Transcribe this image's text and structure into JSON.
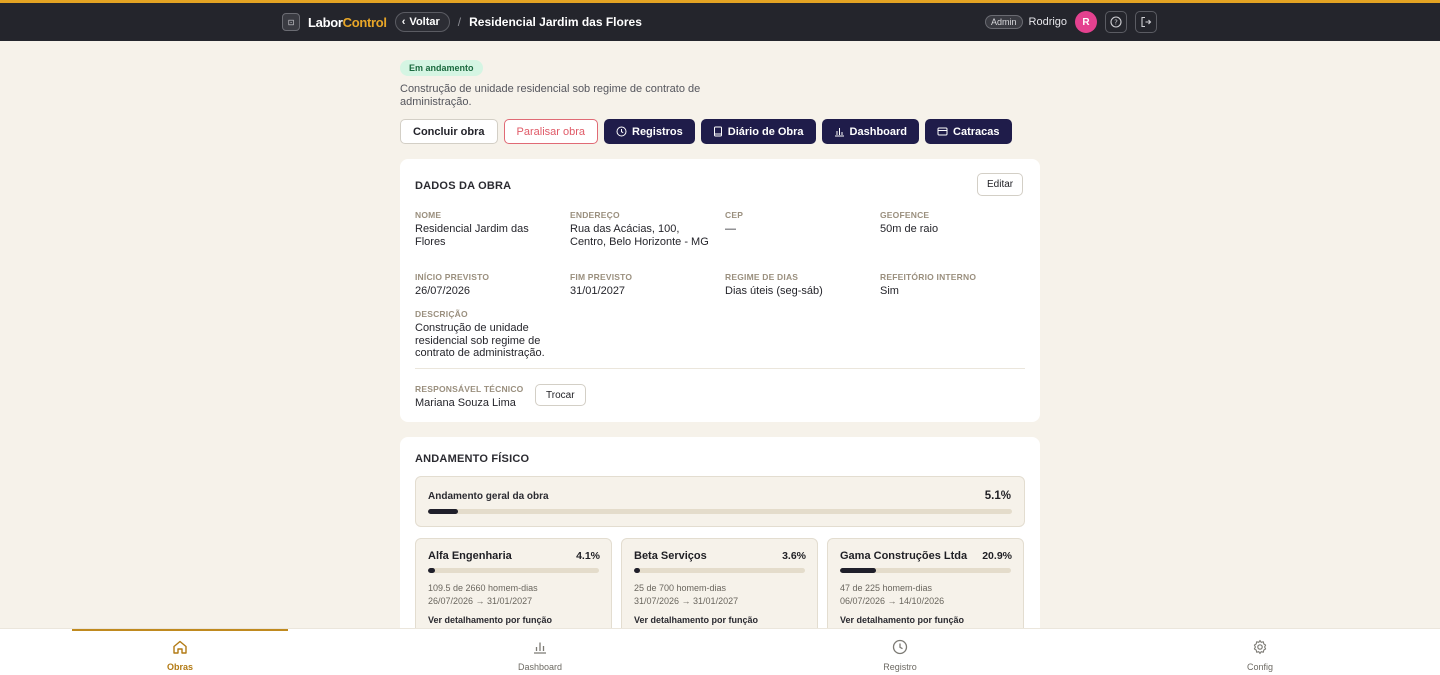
{
  "header": {
    "brand_part1": "Labor",
    "brand_part2": "Control",
    "back_label": "Voltar",
    "breadcrumb_sep": "/",
    "page_title": "Residencial Jardim das Flores",
    "role_badge": "Admin",
    "user_name": "Rodrigo",
    "avatar_initial": "R",
    "accent_color": "#e3a323"
  },
  "status": "Em andamento",
  "description": "Construção de unidade residencial sob regime de contrato de administração.",
  "actions": {
    "finish": "Concluir obra",
    "pause": "Paralisar obra",
    "records": "Registros",
    "diary": "Diário de Obra",
    "dashboard": "Dashboard",
    "turnstiles": "Catracas"
  },
  "details": {
    "title": "DADOS DA OBRA",
    "edit": "Editar",
    "fields": {
      "name": {
        "label": "NOME",
        "value": "Residencial Jardim das Flores"
      },
      "address": {
        "label": "ENDEREÇO",
        "value": "Rua das Acácias, 100, Centro, Belo Horizonte - MG"
      },
      "cep": {
        "label": "CEP",
        "value": "—"
      },
      "geofence": {
        "label": "GEOFENCE",
        "value": "50m de raio"
      },
      "start": {
        "label": "INÍCIO PREVISTO",
        "value": "26/07/2026"
      },
      "end": {
        "label": "FIM PREVISTO",
        "value": "31/01/2027"
      },
      "regime": {
        "label": "REGIME DE DIAS",
        "value": "Dias úteis (seg-sáb)"
      },
      "canteen": {
        "label": "REFEITÓRIO INTERNO",
        "value": "Sim"
      },
      "description": {
        "label": "DESCRIÇÃO",
        "value": "Construção de unidade residencial sob regime de contrato de administração."
      },
      "responsible": {
        "label": "RESPONSÁVEL TÉCNICO",
        "value": "Mariana Souza Lima"
      }
    },
    "swap": "Trocar"
  },
  "progress": {
    "title": "ANDAMENTO FÍSICO",
    "overall_label": "Andamento geral da obra",
    "overall_value": "5.1%",
    "overall_fraction": 0.051,
    "companies": [
      {
        "name": "Alfa Engenharia",
        "percent": "4.1%",
        "fraction": 0.041,
        "mandays": "109.5 de 2660 homem-dias",
        "dates": "26/07/2026 → 31/01/2027",
        "link": "Ver detalhamento por função"
      },
      {
        "name": "Beta Serviços",
        "percent": "3.6%",
        "fraction": 0.036,
        "mandays": "25 de 700 homem-dias",
        "dates": "31/07/2026 → 31/01/2027",
        "link": "Ver detalhamento por função"
      },
      {
        "name": "Gama Construções Ltda",
        "percent": "20.9%",
        "fraction": 0.209,
        "mandays": "47 de 225 homem-dias",
        "dates": "06/07/2026 → 14/10/2026",
        "link": "Ver detalhamento por função"
      }
    ]
  },
  "nav": {
    "items": [
      {
        "label": "Obras",
        "icon": "home-icon"
      },
      {
        "label": "Dashboard",
        "icon": "bar-chart-icon"
      },
      {
        "label": "Registro",
        "icon": "clock-icon"
      },
      {
        "label": "Config",
        "icon": "gear-icon"
      }
    ]
  }
}
